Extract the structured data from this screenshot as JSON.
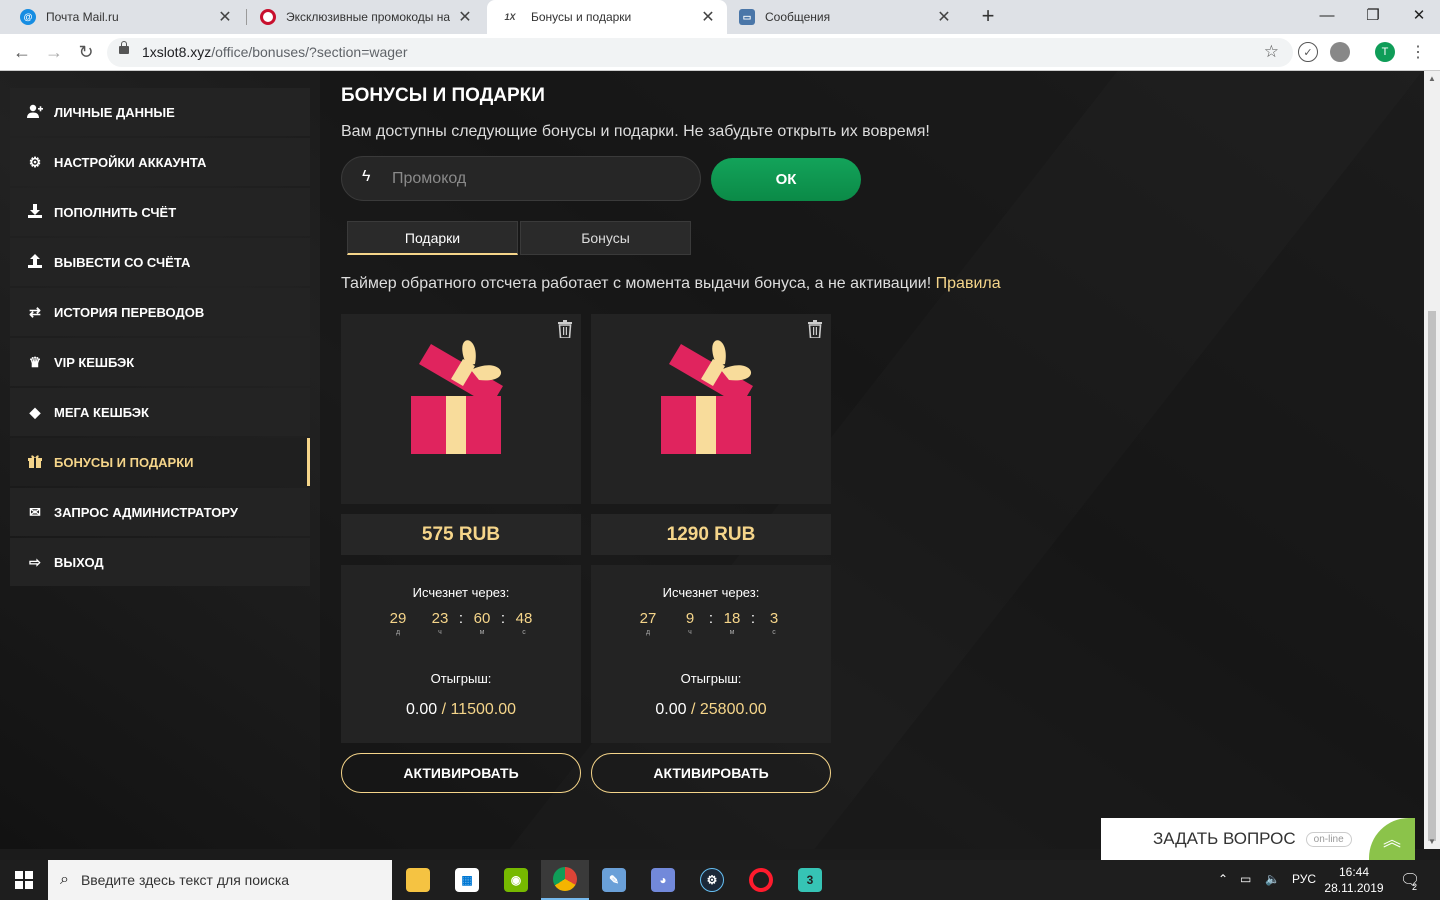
{
  "browser": {
    "tabs": [
      {
        "title": "Почта Mail.ru",
        "active": false
      },
      {
        "title": "Эксклюзивные промокоды на ф",
        "active": false
      },
      {
        "title": "Бонусы и подарки",
        "active": true
      },
      {
        "title": "Сообщения",
        "active": false
      }
    ],
    "new_tab": "+",
    "url_domain": "1xslot8.xyz",
    "url_path": "/office/bonuses/?section=wager",
    "profile_initial": "T"
  },
  "sidebar": {
    "items": [
      {
        "label": "ЛИЧНЫЕ ДАННЫЕ",
        "icon": "user-plus-icon"
      },
      {
        "label": "НАСТРОЙКИ АККАУНТА",
        "icon": "gears-icon"
      },
      {
        "label": "ПОПОЛНИТЬ СЧЁТ",
        "icon": "download-icon"
      },
      {
        "label": "ВЫВЕСТИ СО СЧЁТА",
        "icon": "upload-icon"
      },
      {
        "label": "ИСТОРИЯ ПЕРЕВОДОВ",
        "icon": "transfer-arrows-icon"
      },
      {
        "label": "VIP КЕШБЭК",
        "icon": "crown-icon"
      },
      {
        "label": "МЕГА КЕШБЭК",
        "icon": "diamond-icon"
      },
      {
        "label": "БОНУСЫ И ПОДАРКИ",
        "icon": "gift-icon",
        "active": true
      },
      {
        "label": "ЗАПРОС АДМИНИСТРАТОРУ",
        "icon": "envelope-icon"
      },
      {
        "label": "ВЫХОД",
        "icon": "logout-icon"
      }
    ]
  },
  "main": {
    "title": "БОНУСЫ И ПОДАРКИ",
    "subtitle": "Вам доступны следующие бонусы и подарки. Не забудьте открыть их вовремя!",
    "promo_placeholder": "Промокод",
    "ok_label": "ОК",
    "tabs": [
      {
        "label": "Подарки",
        "active": true
      },
      {
        "label": "Бонусы",
        "active": false
      }
    ],
    "notice": "Таймер обратного отсчета работает с момента выдачи бонуса, а не активации!",
    "rules_link": "Правила"
  },
  "cards": [
    {
      "amount": "575 RUB",
      "expires_label": "Исчезнет через:",
      "timer": {
        "d": "29",
        "h": "23",
        "m": "60",
        "s": "48"
      },
      "units": {
        "d": "д",
        "h": "ч",
        "m": "м",
        "s": "с"
      },
      "wager_label": "Отыгрыш:",
      "wager_done": "0.00",
      "wager_total": "/ 11500.00",
      "activate_label": "АКТИВИРОВАТЬ"
    },
    {
      "amount": "1290 RUB",
      "expires_label": "Исчезнет через:",
      "timer": {
        "d": "27",
        "h": "9",
        "m": "18",
        "s": "3"
      },
      "units": {
        "d": "д",
        "h": "ч",
        "m": "м",
        "s": "с"
      },
      "wager_label": "Отыгрыш:",
      "wager_done": "0.00",
      "wager_total": "/ 25800.00",
      "activate_label": "АКТИВИРОВАТЬ"
    }
  ],
  "chat_widget": {
    "label": "ЗАДАТЬ ВОПРОС",
    "status": "on-line"
  },
  "taskbar": {
    "search_placeholder": "Введите здесь текст для поиска",
    "lang": "РУС",
    "time": "16:44",
    "date": "28.11.2019",
    "notifications": "2"
  },
  "colors": {
    "accent": "#f5d58a",
    "ok": "#0f9a50",
    "gift_box": "#e0245e",
    "gift_ribbon": "#f8dc9b"
  }
}
